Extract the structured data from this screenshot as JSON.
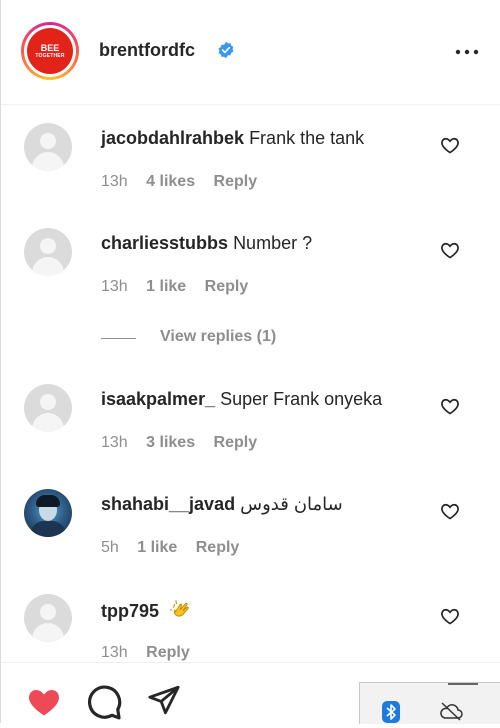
{
  "header": {
    "username": "brentfordfc",
    "logo_line1": "BEE",
    "logo_line2": "TOGETHER",
    "verified_icon": "verified-badge-icon",
    "more_icon": "more-dots-icon"
  },
  "comments": [
    {
      "username": "jacobdahlrahbek",
      "text": "Frank the tank",
      "time": "13h",
      "likes": "4 likes",
      "reply": "Reply"
    },
    {
      "username": "charliesstubbs",
      "text": "Number ?",
      "time": "13h",
      "likes": "1 like",
      "reply": "Reply"
    },
    {
      "username": "isaakpalmer_",
      "text": "Super Frank onyeka",
      "time": "13h",
      "likes": "3 likes",
      "reply": "Reply"
    },
    {
      "username": "shahabi__javad",
      "text": "سامان قدوس",
      "time": "5h",
      "likes": "1 like",
      "reply": "Reply"
    },
    {
      "username": "tpp795",
      "text": "",
      "time": "13h",
      "likes": "",
      "reply": "Reply"
    }
  ],
  "view_replies": "View replies (1)",
  "colors": {
    "like_red": "#ed4956",
    "text": "#262626",
    "muted": "#8e8e8e",
    "verified_blue": "#3897f0"
  },
  "footer_icons": [
    "heart-filled-icon",
    "comment-icon",
    "share-icon"
  ],
  "tray_icons": [
    "bluetooth-icon",
    "cloud-offline-icon"
  ]
}
